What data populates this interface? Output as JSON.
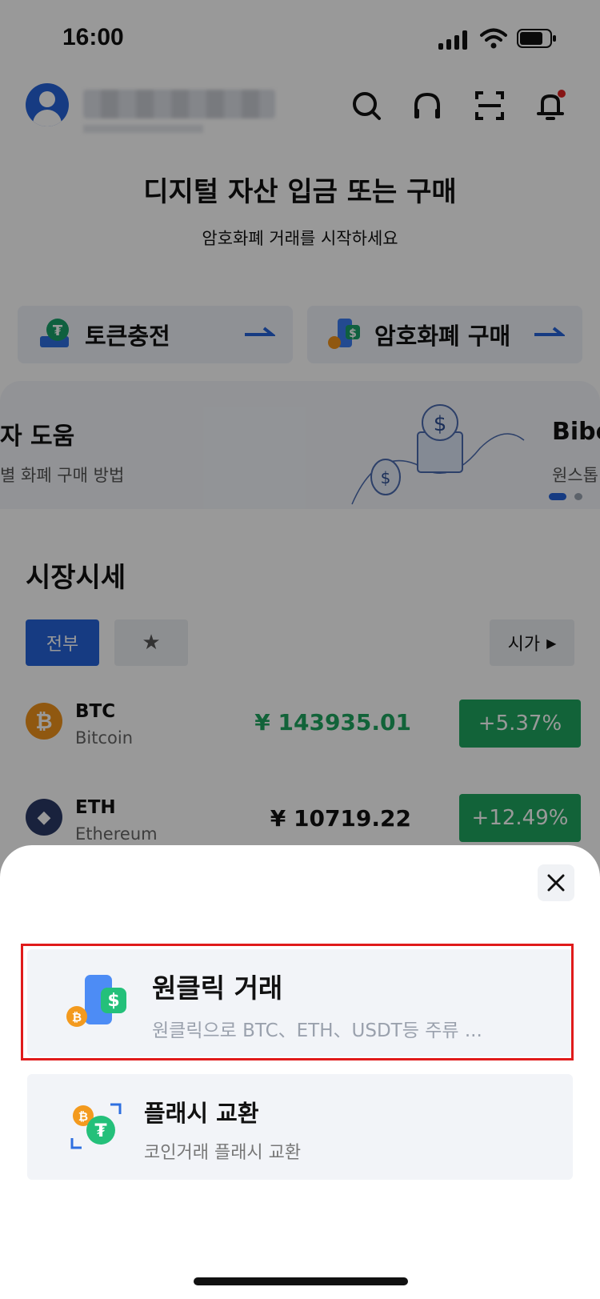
{
  "status_bar": {
    "time": "16:00"
  },
  "header": {
    "icons": [
      "search-icon",
      "headset-icon",
      "scan-icon",
      "notification-icon"
    ],
    "hero_title": "디지털 자산 입금 또는 구매",
    "hero_subtitle": "암호화폐 거래를 시작하세요"
  },
  "actions": [
    {
      "label": "토큰충전"
    },
    {
      "label": "암호화폐 구매"
    }
  ],
  "banner": {
    "left_title": "자 도움",
    "left_subtitle": "별 화폐 구매 방법",
    "right_title": "Bibo",
    "right_subtitle": "원스톱"
  },
  "market": {
    "title": "시장시세",
    "tab_all": "전부",
    "sort_label": "시가",
    "rows": [
      {
        "symbol": "BTC",
        "name": "Bitcoin",
        "price": "¥ 143935.01",
        "change": "+5.37%",
        "icon_glyph": "₿",
        "color": "#f0931b",
        "price_color": "#1fa55f"
      },
      {
        "symbol": "ETH",
        "name": "Ethereum",
        "price": "¥ 10719.22",
        "change": "+12.49%",
        "icon_glyph": "◆",
        "color": "#2b3a67",
        "price_color": "#111111"
      }
    ]
  },
  "sheet": {
    "options": [
      {
        "title": "원클릭 거래",
        "desc": "원클릭으로 BTC、ETH、USDT등 주류 ..."
      },
      {
        "title": "플래시 교환",
        "desc": "코인거래 플래시 교환"
      }
    ]
  },
  "colors": {
    "brand_blue": "#2563d9",
    "up_green": "#1fa55f",
    "highlight_red": "#e01b1b"
  }
}
